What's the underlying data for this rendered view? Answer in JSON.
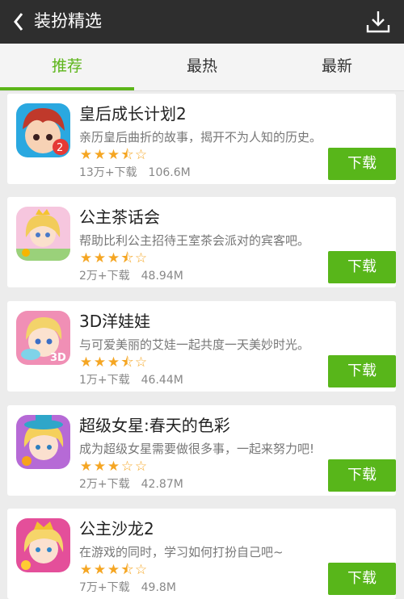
{
  "header": {
    "title": "装扮精选",
    "back_icon": "chevron-left-icon",
    "download_icon": "download-icon"
  },
  "tabs": [
    {
      "label": "推荐",
      "active": true
    },
    {
      "label": "最热",
      "active": false
    },
    {
      "label": "最新",
      "active": false
    }
  ],
  "colors": {
    "accent": "#5cb519",
    "topbar": "#2e2e2e",
    "star": "#f5a623"
  },
  "apps": [
    {
      "name": "皇后成长计划2",
      "desc": "亲历皇后曲折的故事，揭开不为人知的历史。",
      "rating": 3.5,
      "downloads": "13万+下载",
      "size": "106.6M",
      "button": "下载"
    },
    {
      "name": "公主茶话会",
      "desc": "帮助比利公主招待王室茶会派对的宾客吧。",
      "rating": 3.5,
      "downloads": "2万+下载",
      "size": "48.94M",
      "button": "下载"
    },
    {
      "name": "3D洋娃娃",
      "desc": "与可爱美丽的艾娃一起共度一天美妙时光。",
      "rating": 3.5,
      "downloads": "1万+下载",
      "size": "46.44M",
      "button": "下载"
    },
    {
      "name": "超级女星:春天的色彩",
      "desc": "成为超级女星需要做很多事，一起来努力吧!",
      "rating": 3,
      "downloads": "2万+下载",
      "size": "42.87M",
      "button": "下载"
    },
    {
      "name": "公主沙龙2",
      "desc": "在游戏的同时，学习如何打扮自己吧~",
      "rating": 3.5,
      "downloads": "7万+下载",
      "size": "49.8M",
      "button": "下载"
    }
  ]
}
